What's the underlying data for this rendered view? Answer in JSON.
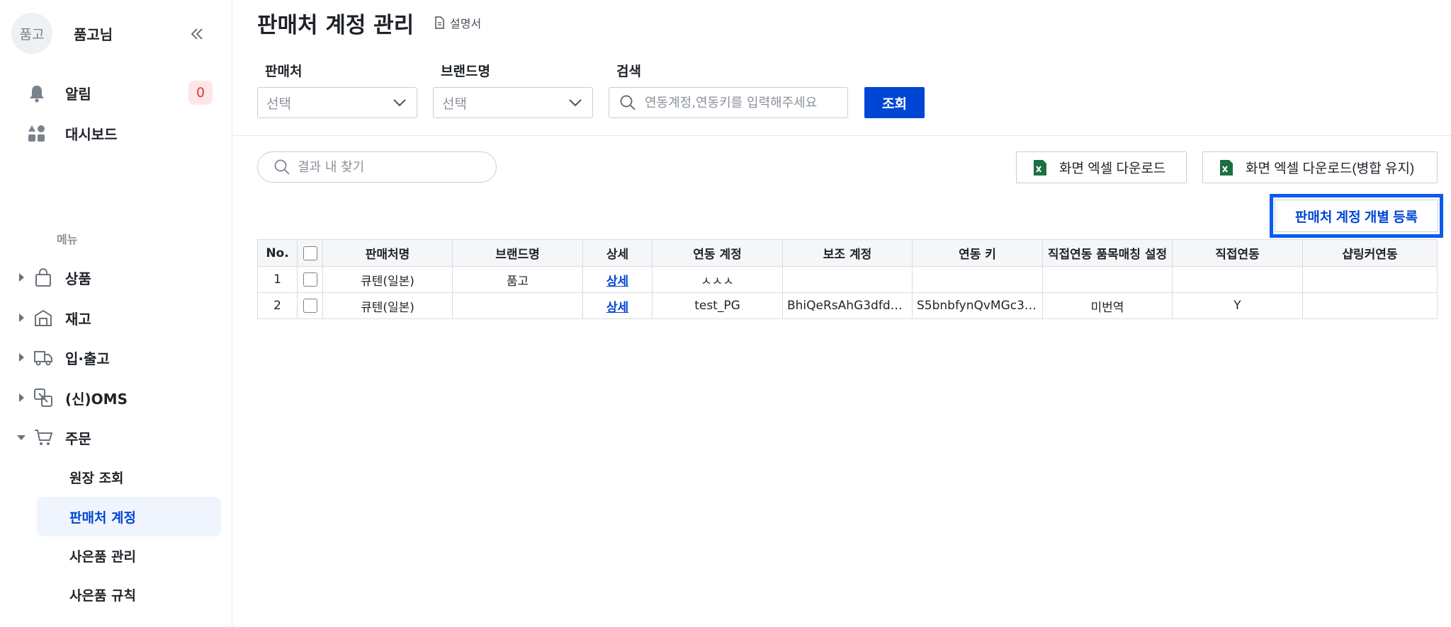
{
  "profile": {
    "avatar_text": "품고",
    "name": "품고님"
  },
  "nav_top": [
    {
      "label": "알림",
      "badge": "0",
      "icon": "bell-icon"
    },
    {
      "label": "대시보드",
      "icon": "dashboard-icon"
    }
  ],
  "menu_heading": "메뉴",
  "menu": [
    {
      "label": "상품",
      "icon": "bag-icon"
    },
    {
      "label": "재고",
      "icon": "warehouse-icon"
    },
    {
      "label": "입·출고",
      "icon": "truck-icon"
    },
    {
      "label": "(신)OMS",
      "icon": "oms-icon"
    },
    {
      "label": "주문",
      "icon": "cart-icon"
    }
  ],
  "submenu": [
    {
      "label": "원장 조회"
    },
    {
      "label": "판매처 계정",
      "active": true
    },
    {
      "label": "사은품 관리"
    },
    {
      "label": "사은품 규칙"
    }
  ],
  "page": {
    "title": "판매처 계정 관리",
    "manual_label": "설명서"
  },
  "filters": {
    "seller_label": "판매처",
    "seller_value": "선택",
    "brand_label": "브랜드명",
    "brand_value": "선택",
    "search_label": "검색",
    "search_placeholder": "연동계정,연동키를 입력해주세요",
    "query_button": "조회"
  },
  "result_search_placeholder": "결과 내 찾기",
  "actions": {
    "excel_download": "화면 엑셀 다운로드",
    "excel_download_merge": "화면 엑셀 다운로드(병합 유지)",
    "register": "판매처 계정 개별 등록"
  },
  "table": {
    "headers": [
      "No.",
      "",
      "판매처명",
      "브랜드명",
      "상세",
      "연동 계정",
      "보조 계정",
      "연동 키",
      "직접연동 품목매칭 설정",
      "직접연동",
      "샵링커연동"
    ],
    "rows": [
      {
        "no": "1",
        "seller": "큐텐(일본)",
        "brand": "품고",
        "detail": "상세",
        "account": "ㅅㅅㅅ",
        "sub_account": "",
        "key": "",
        "matching": "",
        "direct": "",
        "shoplinker": ""
      },
      {
        "no": "2",
        "seller": "큐텐(일본)",
        "brand": "",
        "detail": "상세",
        "account": "test_PG",
        "sub_account": "BhiQeRsAhG3dfd…",
        "key": "S5bnbfynQvMGc3…",
        "matching": "미번역",
        "direct": "Y",
        "shoplinker": ""
      }
    ]
  },
  "colors": {
    "accent": "#0046d5",
    "highlight": "#0a5bf0",
    "badge": "#e8343a",
    "excel": "#1d6f42"
  }
}
